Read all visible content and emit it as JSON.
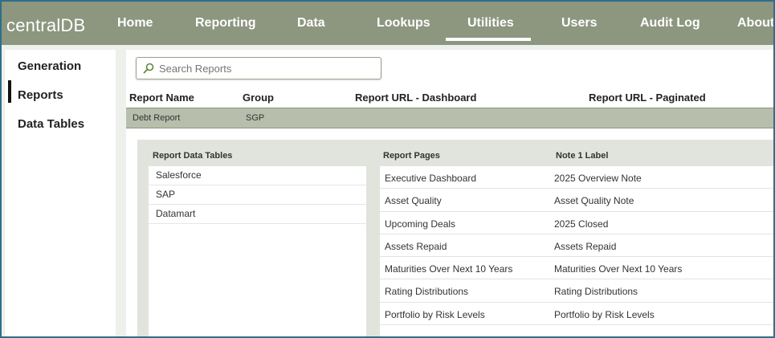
{
  "app": {
    "brand": "centralDB"
  },
  "nav": {
    "items": [
      {
        "label": "Home"
      },
      {
        "label": "Reporting"
      },
      {
        "label": "Data"
      },
      {
        "label": "Lookups"
      },
      {
        "label": "Utilities"
      },
      {
        "label": "Users"
      },
      {
        "label": "Audit Log"
      },
      {
        "label": "About"
      }
    ],
    "active": "Utilities"
  },
  "sidebar": {
    "items": [
      {
        "label": "Generation"
      },
      {
        "label": "Reports"
      },
      {
        "label": "Data Tables"
      }
    ],
    "active": "Reports"
  },
  "search": {
    "placeholder": "Search Reports",
    "value": ""
  },
  "reports_table": {
    "headers": [
      "Report Name",
      "Group",
      "Report URL - Dashboard",
      "Report URL - Paginated"
    ],
    "rows": [
      {
        "name": "Debt Report",
        "group": "SGP",
        "dashboard_url": "",
        "paginated_url": ""
      }
    ]
  },
  "detail": {
    "tables_header": "Report Data Tables",
    "tables": [
      "Salesforce",
      "SAP",
      "Datamart"
    ],
    "pages_header": "Report Pages",
    "note_header": "Note 1 Label",
    "pages": [
      {
        "page": "Executive Dashboard",
        "note": "2025 Overview Note"
      },
      {
        "page": "Asset Quality",
        "note": "Asset Quality Note"
      },
      {
        "page": "Upcoming Deals",
        "note": "2025 Closed"
      },
      {
        "page": "Assets Repaid",
        "note": "Assets Repaid"
      },
      {
        "page": "Maturities Over Next 10 Years",
        "note": "Maturities Over Next 10 Years"
      },
      {
        "page": "Rating Distributions",
        "note": "Rating Distributions"
      },
      {
        "page": "Portfolio by Risk Levels",
        "note": "Portfolio by Risk Levels"
      }
    ]
  },
  "colors": {
    "topbar": "#8d967f",
    "selected_row": "#b7bfac",
    "detail_panel": "#e1e4dc",
    "frame_border": "#2f6f8a",
    "search_icon": "#5a8a3a"
  },
  "icons": {
    "search": "search-icon"
  }
}
